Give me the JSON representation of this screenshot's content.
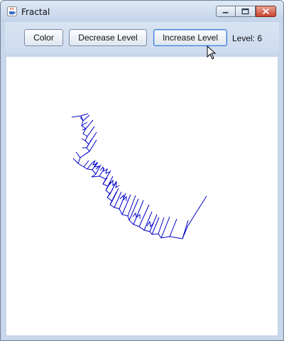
{
  "window": {
    "title": "Fractal",
    "icon": "java-cup-icon",
    "controls": [
      "minimize-icon",
      "maximize-icon",
      "close-icon"
    ]
  },
  "toolbar": {
    "color_label": "Color",
    "decrease_label": "Decrease Level",
    "increase_label": "Increase Level",
    "level_text": "Level: 6"
  },
  "fractal": {
    "stroke_color": "#0000cc",
    "background": "#ffffff"
  },
  "cursor": "arrow-cursor-icon"
}
